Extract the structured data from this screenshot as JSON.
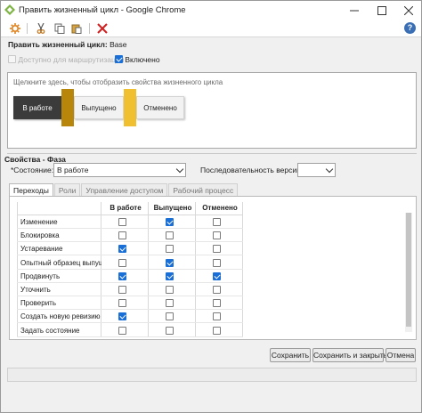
{
  "window": {
    "title": "Править жизненный цикл - Google Chrome",
    "controls": [
      "minimize-icon",
      "maximize-icon",
      "close-icon"
    ]
  },
  "toolbar": {
    "icons": [
      "gear-icon",
      "cut-icon",
      "copy-icon",
      "paste-icon",
      "delete-icon"
    ]
  },
  "lifecycle": {
    "label": "Править жизненный цикл:",
    "name": "Base",
    "routing_label": "Доступно для маршрутизации",
    "routing_checked": false,
    "enabled_label": "Включено",
    "enabled_checked": true
  },
  "canvas": {
    "hint": "Щелкните здесь, чтобы отобразить свойства жизненного цикла",
    "phases": [
      {
        "label": "В работе",
        "color": "#3b3b3b",
        "text_color": "#ffffff"
      },
      {
        "label": "Выпущено",
        "color": "#f2f2f2",
        "text_color": "#222222"
      },
      {
        "label": "Отменено",
        "color": "#f2f2f2",
        "text_color": "#222222"
      }
    ],
    "connector_colors": [
      "#b8860b",
      "#f0c030"
    ]
  },
  "phase_props": {
    "group_label": "Свойства - Фаза",
    "state_label": "*Состояние:",
    "state_value": "В работе",
    "version_seq_label": "Последовательность версий:",
    "version_seq_value": ""
  },
  "tabs": [
    {
      "label": "Переходы",
      "active": true
    },
    {
      "label": "Роли",
      "active": false
    },
    {
      "label": "Управление доступом",
      "active": false
    },
    {
      "label": "Рабочий процесс",
      "active": false
    }
  ],
  "transitions": {
    "columns": [
      "В работе",
      "Выпущено",
      "Отменено"
    ],
    "rows": [
      {
        "label": "Изменение",
        "values": [
          false,
          true,
          false
        ]
      },
      {
        "label": "Блокировка",
        "values": [
          false,
          false,
          false
        ]
      },
      {
        "label": "Устаревание",
        "values": [
          true,
          false,
          false
        ]
      },
      {
        "label": "Опытный образец выпуще",
        "values": [
          false,
          true,
          false
        ]
      },
      {
        "label": "Продвинуть",
        "values": [
          true,
          true,
          true
        ]
      },
      {
        "label": "Уточнить",
        "values": [
          false,
          false,
          false
        ]
      },
      {
        "label": "Проверить",
        "values": [
          false,
          false,
          false
        ]
      },
      {
        "label": "Создать новую ревизию",
        "values": [
          true,
          false,
          false
        ]
      },
      {
        "label": "Задать состояние",
        "values": [
          false,
          false,
          false
        ]
      }
    ]
  },
  "buttons": {
    "save": "Сохранить",
    "save_close": "Сохранить и закрыть",
    "cancel": "Отмена"
  }
}
